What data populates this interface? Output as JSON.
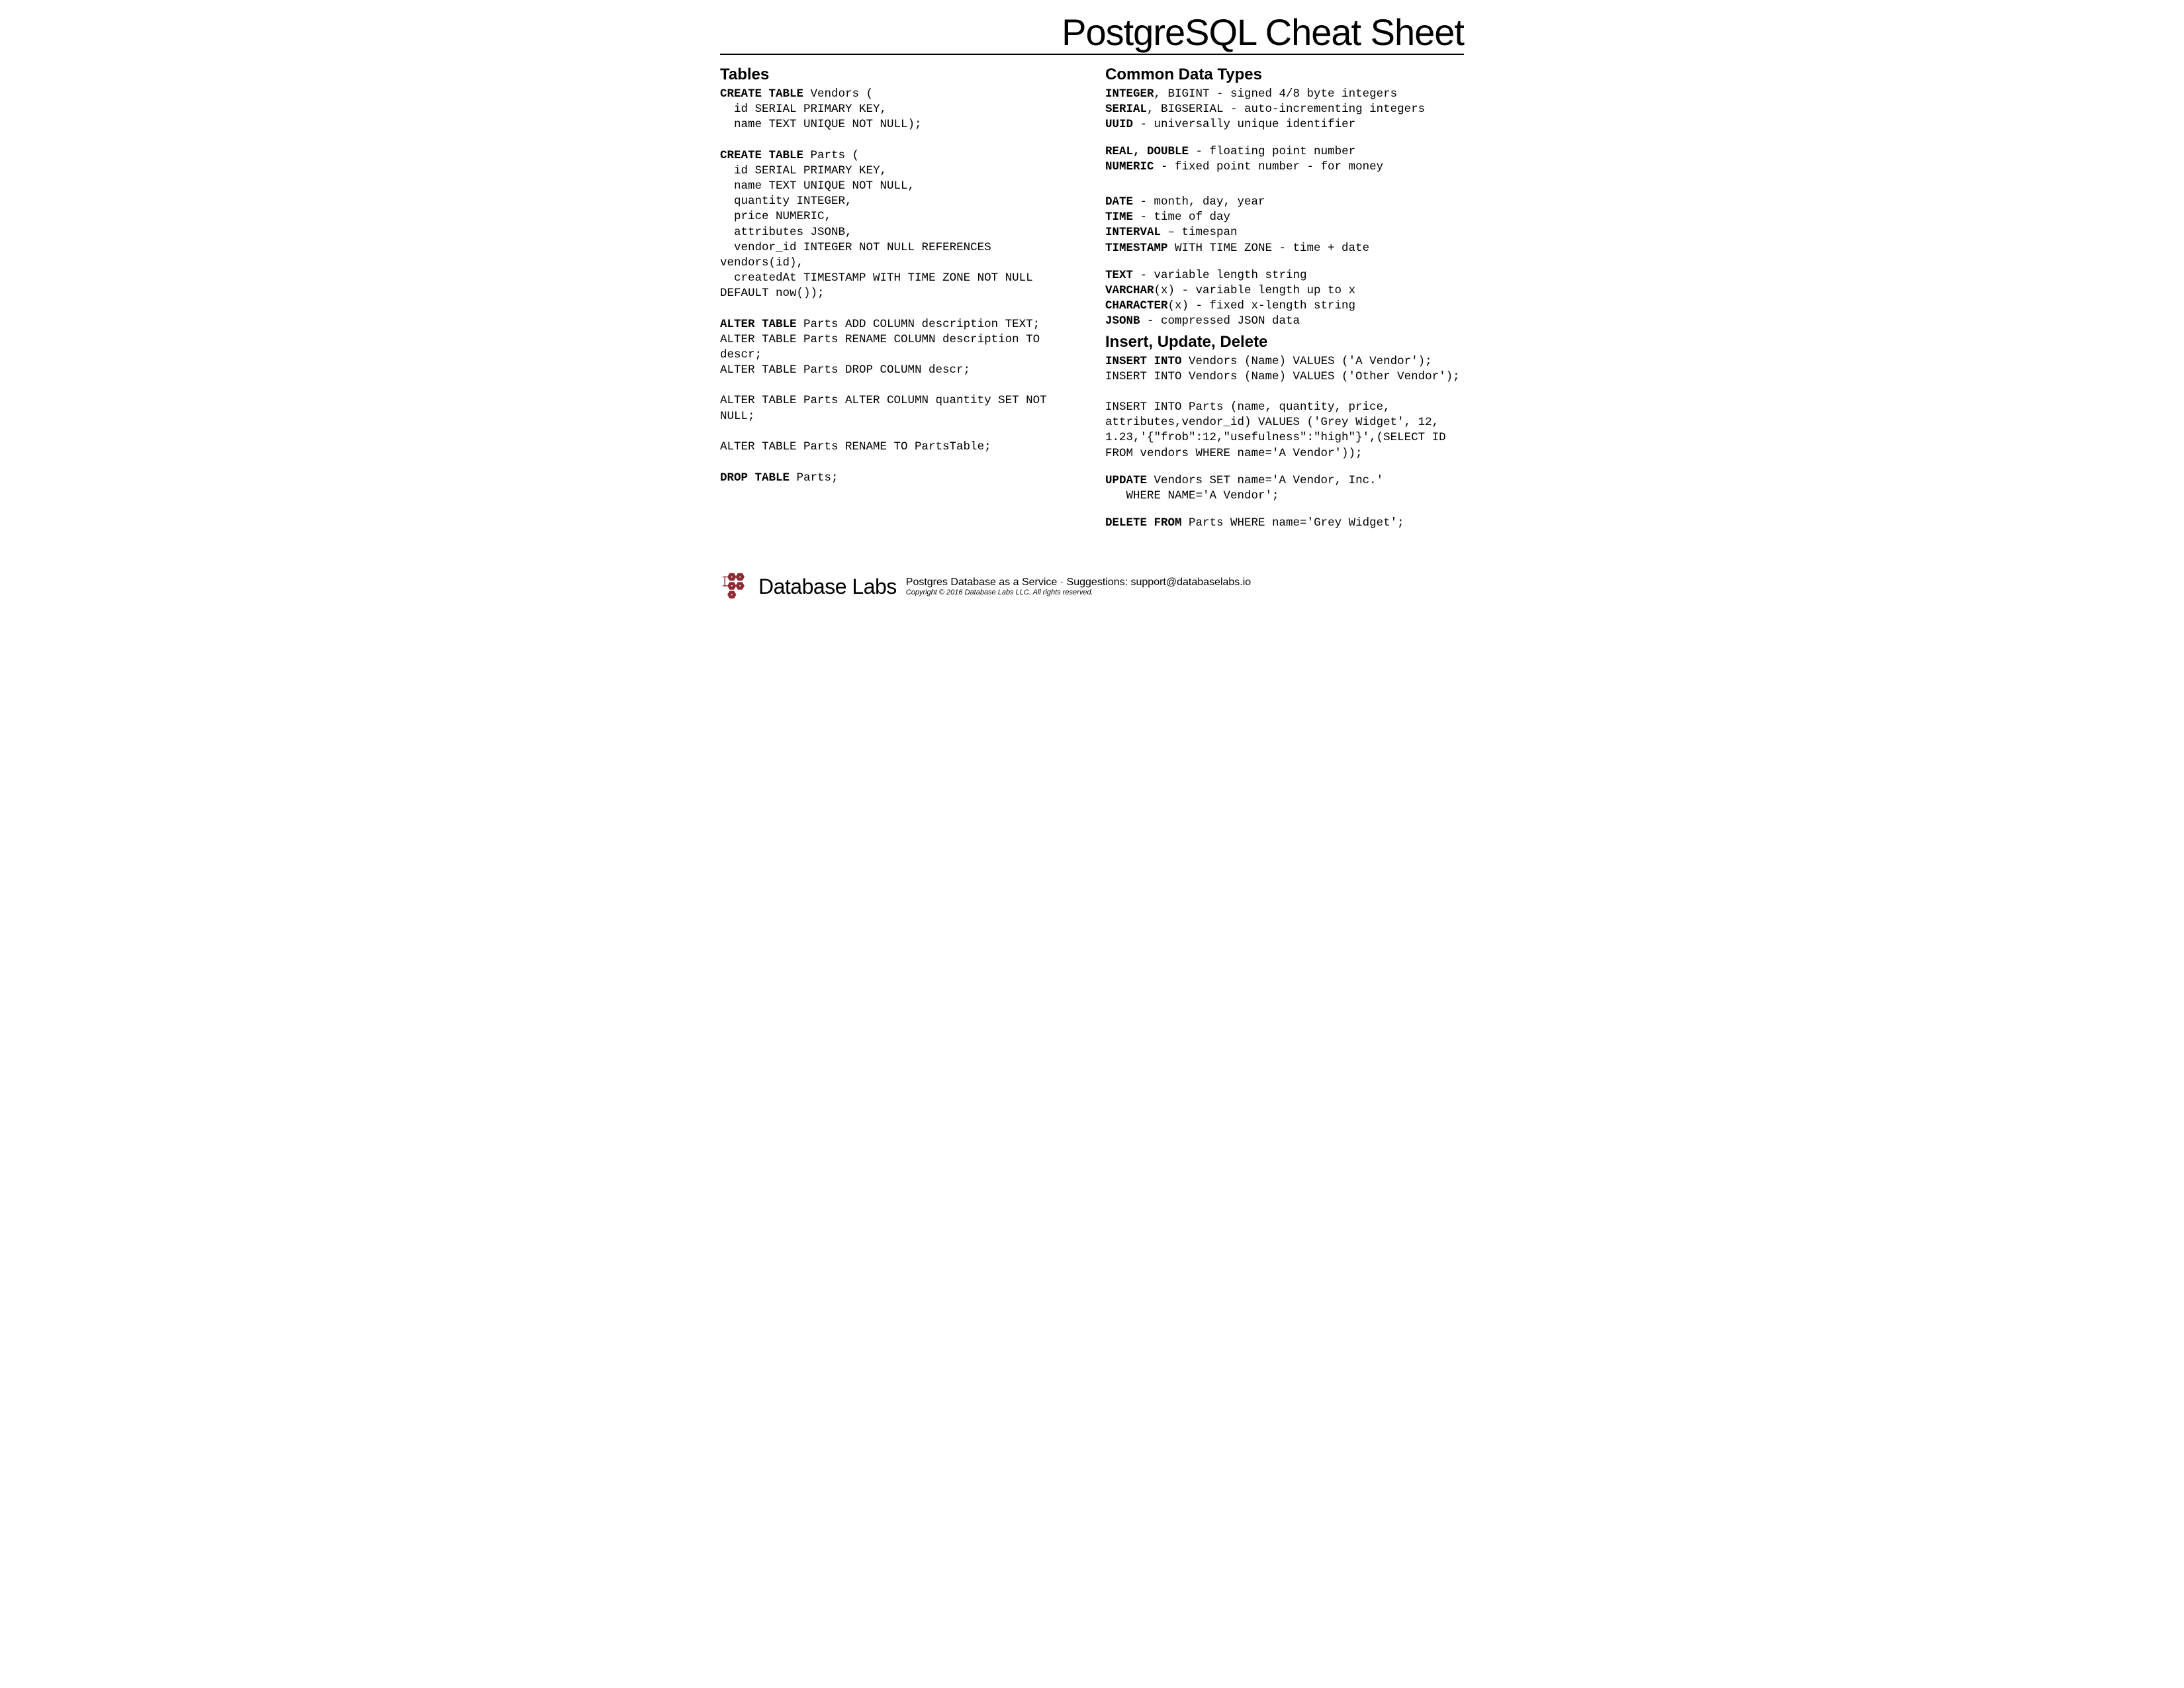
{
  "title": "PostgreSQL Cheat Sheet",
  "left": {
    "section_tables": "Tables",
    "create_vendors_l1": "CREATE TABLE",
    "create_vendors_l1b": " Vendors (",
    "create_vendors_l2": "  id SERIAL PRIMARY KEY,",
    "create_vendors_l3": "  name TEXT UNIQUE NOT NULL);",
    "create_parts_l1": "CREATE TABLE",
    "create_parts_l1b": " Parts (",
    "create_parts_l2": "  id SERIAL PRIMARY KEY,",
    "create_parts_l3": "  name TEXT UNIQUE NOT NULL,",
    "create_parts_l4": "  quantity INTEGER,",
    "create_parts_l5": "  price NUMERIC,",
    "create_parts_l6": "  attributes JSONB,",
    "create_parts_l7": "  vendor_id INTEGER NOT NULL REFERENCES vendors(id),",
    "create_parts_l8": "  createdAt TIMESTAMP WITH TIME ZONE NOT NULL DEFAULT now());",
    "alter_l1a": "ALTER TABLE",
    "alter_l1b": " Parts ADD COLUMN description TEXT;",
    "alter_l2": "ALTER TABLE Parts RENAME COLUMN description TO descr;",
    "alter_l3": "ALTER TABLE Parts DROP COLUMN descr;",
    "alter_l4": "ALTER TABLE Parts ALTER COLUMN quantity SET NOT NULL;",
    "alter_l5": "ALTER TABLE Parts RENAME TO PartsTable;",
    "drop_a": "DROP TABLE",
    "drop_b": " Parts;"
  },
  "right": {
    "section_types": "Common Data Types",
    "t_integer_a": "INTEGER",
    "t_integer_b": ", BIGINT - signed 4/8 byte integers",
    "t_serial_a": "SERIAL",
    "t_serial_b": ", BIGSERIAL - auto-incrementing integers",
    "t_uuid_a": "UUID",
    "t_uuid_b": " - universally unique identifier",
    "t_real_a": "REAL, DOUBLE",
    "t_real_b": " - floating point number",
    "t_numeric_a": "NUMERIC",
    "t_numeric_b": " - fixed point number - for money",
    "t_date_a": "DATE",
    "t_date_b": " - month, day, year",
    "t_time_a": "TIME",
    "t_time_b": " - time of day",
    "t_interval_a": "INTERVAL",
    "t_interval_b": " – timespan",
    "t_timestamp_a": "TIMESTAMP",
    "t_timestamp_b": " WITH TIME ZONE - time + date",
    "t_text_a": "TEXT",
    "t_text_b": " - variable length string",
    "t_varchar_a": "VARCHAR",
    "t_varchar_b": "(x) - variable length up to x",
    "t_character_a": "CHARACTER",
    "t_character_b": "(x) - fixed x-length string",
    "t_jsonb_a": "JSONB",
    "t_jsonb_b": " - compressed JSON data",
    "section_iud": "Insert, Update, Delete",
    "ins1_a": "INSERT INTO",
    "ins1_b": " Vendors (Name) VALUES ('A Vendor');",
    "ins2": "INSERT INTO Vendors (Name) VALUES ('Other Vendor');",
    "ins3": "INSERT INTO Parts (name, quantity, price, attributes,vendor_id) VALUES ('Grey Widget', 12, 1.23,'{\"frob\":12,\"usefulness\":\"high\"}',(SELECT ID FROM vendors WHERE name='A Vendor'));",
    "upd_a": "UPDATE",
    "upd_b": " Vendors SET name='A Vendor, Inc.'",
    "upd_c": "   WHERE NAME='A Vendor';",
    "del_a": "DELETE FROM",
    "del_b": " Parts WHERE name='Grey Widget';"
  },
  "footer": {
    "brand": "Database Labs",
    "tagline": "Postgres Database as a Service ·  Suggestions: support@databaselabs.io",
    "copyright": "Copyright © 2016 Database Labs LLC. All rights reserved."
  }
}
